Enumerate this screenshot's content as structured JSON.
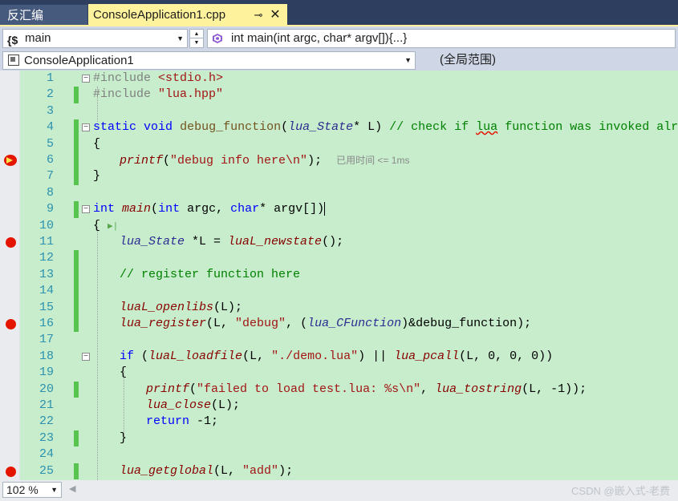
{
  "tabs": {
    "inactive_label": "反汇编",
    "active_label": "ConsoleApplication1.cpp",
    "pin_glyph": "⊸",
    "close_glyph": "✕"
  },
  "nav": {
    "scope_icon": "{$",
    "scope_value": "main",
    "function_value": "int main(int argc, char* argv[]){...}",
    "project_value": "ConsoleApplication1",
    "global_scope": "(全局范围)"
  },
  "colors": {
    "keyword": "#0000ff",
    "comment": "#008000",
    "string": "#a31515",
    "function_italic": "#880000",
    "type_italic": "#2b2b91",
    "line_number": "#2b91af",
    "breakpoint": "#e51400",
    "change_bar": "#57c44f",
    "editor_bg": "#c7edcc",
    "active_tab": "#fff29d"
  },
  "editor": {
    "line_numbers": [
      "1",
      "2",
      "3",
      "4",
      "5",
      "6",
      "7",
      "8",
      "9",
      "10",
      "11",
      "12",
      "13",
      "14",
      "15",
      "16",
      "17",
      "18",
      "19",
      "20",
      "21",
      "22",
      "23",
      "24",
      "25"
    ],
    "breakpoint_lines": [
      "6",
      "11",
      "16",
      "25"
    ],
    "code": {
      "l1_pp": "#include ",
      "l1_inc": "<stdio.h>",
      "l2_pp": "#include ",
      "l2_inc": "\"lua.hpp\"",
      "l4_kw1": "static",
      "l4_kw2": "void",
      "l4_fn": "debug_function",
      "l4_p1": "(",
      "l4_ty": "lua_State",
      "l4_p2": "* L) ",
      "l4_cmt1": "// check if ",
      "l4_cmt_lua": "lua",
      "l4_cmt2": " function was invoked already",
      "l5": "{",
      "l6_fn": "printf",
      "l6_p1": "(",
      "l6_str": "\"debug info here\\n\"",
      "l6_p2": ");",
      "l6_hint": "已用时间 <= 1ms",
      "l7": "}",
      "l9_kw1": "int",
      "l9_fn": "main",
      "l9_p1": "(",
      "l9_kw2": "int",
      "l9_p2": " argc, ",
      "l9_kw3": "char",
      "l9_p3": "* argv[])",
      "l10": "{",
      "l10_glyph": "▶|",
      "l11_ty": "lua_State",
      "l11_p1": " *L = ",
      "l11_fn": "luaL_newstate",
      "l11_p2": "();",
      "l13_cmt": "// register function here",
      "l15_fn": "luaL_openlibs",
      "l15_p": "(L);",
      "l16_fn": "lua_register",
      "l16_p1": "(L, ",
      "l16_str": "\"debug\"",
      "l16_p2": ", (",
      "l16_ty": "lua_CFunction",
      "l16_p3": ")&debug_function);",
      "l18_kw": "if",
      "l18_p1": " (",
      "l18_fn1": "luaL_loadfile",
      "l18_p2": "(L, ",
      "l18_str": "\"./demo.lua\"",
      "l18_p3": ") || ",
      "l18_fn2": "lua_pcall",
      "l18_p4": "(L, 0, 0, 0))",
      "l19": "{",
      "l20_fn1": "printf",
      "l20_p1": "(",
      "l20_str": "\"failed to load test.lua: %s\\n\"",
      "l20_p2": ", ",
      "l20_fn2": "lua_tostring",
      "l20_p3": "(L, -1));",
      "l21_fn": "lua_close",
      "l21_p": "(L);",
      "l22_kw": "return",
      "l22_p": " -1;",
      "l23": "}",
      "l25_fn": "lua_getglobal",
      "l25_p1": "(L, ",
      "l25_str": "\"add\"",
      "l25_p2": ");"
    }
  },
  "bottom": {
    "zoom": "102 %",
    "watermark": "CSDN @嵌入式-老费"
  }
}
